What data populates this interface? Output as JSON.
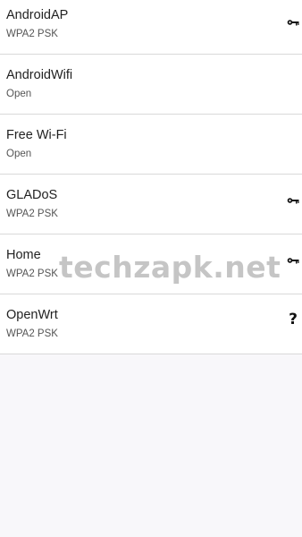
{
  "networks": [
    {
      "ssid": "AndroidAP",
      "security": "WPA2 PSK",
      "icon": "key-icon"
    },
    {
      "ssid": "AndroidWifi",
      "security": "Open",
      "icon": ""
    },
    {
      "ssid": "Free Wi-Fi",
      "security": "Open",
      "icon": ""
    },
    {
      "ssid": "GLADoS",
      "security": "WPA2 PSK",
      "icon": "key-icon"
    },
    {
      "ssid": "Home",
      "security": "WPA2 PSK",
      "icon": "key-icon"
    },
    {
      "ssid": "OpenWrt",
      "security": "WPA2 PSK",
      "icon": "question-mark-icon",
      "icon_text": "?"
    }
  ],
  "watermark": "techzapk.net"
}
